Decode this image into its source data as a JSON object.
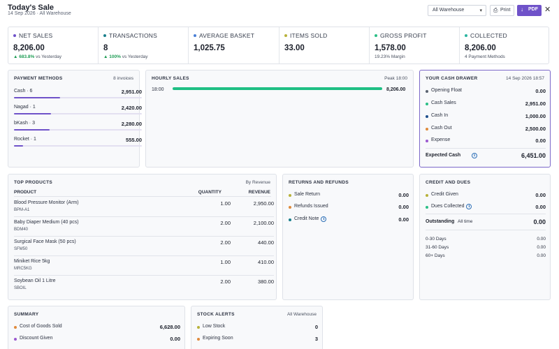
{
  "header": {
    "title": "Today's Sale",
    "subtitle": "14 Sep 2026 · All Warehouse",
    "warehouse_select": "All Warehouse",
    "print_label": "Print",
    "pdf_label": "PDF"
  },
  "kpis": [
    {
      "label": "NET SALES",
      "value": "8,206.00",
      "change": "683.8%",
      "change_text": "vs Yesterday",
      "dot": "#6f52c9"
    },
    {
      "label": "TRANSACTIONS",
      "value": "8",
      "change": "100%",
      "change_text": "vs Yesterday",
      "dot": "#1a7f8c"
    },
    {
      "label": "AVERAGE BASKET",
      "value": "1,025.75",
      "dot": "#4a7fd6"
    },
    {
      "label": "ITEMS SOLD",
      "value": "33.00",
      "dot": "#b8b23a"
    },
    {
      "label": "GROSS PROFIT",
      "value": "1,578.00",
      "sub": "19.23% Margin",
      "dot": "#2bbf86"
    },
    {
      "label": "COLLECTED",
      "value": "8,206.00",
      "sub": "4 Payment Methods",
      "dot": "#2bb5a0"
    }
  ],
  "payment_methods": {
    "title": "PAYMENT METHODS",
    "meta": "8 invoices",
    "items": [
      {
        "name": "Cash · 6",
        "amount": "2,951.00",
        "share": 0.36
      },
      {
        "name": "Nagad · 1",
        "amount": "2,420.00",
        "share": 0.29
      },
      {
        "name": "bKash · 3",
        "amount": "2,280.00",
        "share": 0.28
      },
      {
        "name": "Rocket · 1",
        "amount": "555.00",
        "share": 0.07
      }
    ]
  },
  "hourly_sales": {
    "title": "HOURLY SALES",
    "meta": "Peak 18:00"
  },
  "chart_data": {
    "type": "bar",
    "orientation": "horizontal",
    "categories": [
      "18:00"
    ],
    "values": [
      8206.0
    ],
    "value_labels": [
      "8,206.00"
    ],
    "color": "#1fbf84"
  },
  "cash_drawer": {
    "title": "YOUR CASH DRAWER",
    "meta": "14 Sep 2026 18:57",
    "items": [
      {
        "label": "Opening Float",
        "value": "0.00",
        "dot": "#5a6270"
      },
      {
        "label": "Cash Sales",
        "value": "2,951.00",
        "dot": "#2bbf86"
      },
      {
        "label": "Cash In",
        "value": "1,000.00",
        "dot": "#1f4f8c"
      },
      {
        "label": "Cash Out",
        "value": "2,500.00",
        "dot": "#e08a3c"
      },
      {
        "label": "Expense",
        "value": "0.00",
        "dot": "#9b59d0"
      }
    ],
    "expected_label": "Expected Cash",
    "expected_value": "6,451.00"
  },
  "top_products": {
    "title": "TOP PRODUCTS",
    "meta": "By Revenue",
    "columns": [
      "PRODUCT",
      "QUANTITY",
      "REVENUE"
    ],
    "rows": [
      {
        "name": "Blood Pressure Monitor (Arm)",
        "sku": "BPM-A1",
        "qty": "1.00",
        "revenue": "2,950.00"
      },
      {
        "name": "Baby Diaper Medium (40 pcs)",
        "sku": "BDM40",
        "qty": "2.00",
        "revenue": "2,100.00"
      },
      {
        "name": "Surgical Face Mask (50 pcs)",
        "sku": "SFM50",
        "qty": "2.00",
        "revenue": "440.00"
      },
      {
        "name": "Miniket Rice 5kg",
        "sku": "MRC5KG",
        "qty": "1.00",
        "revenue": "410.00"
      },
      {
        "name": "Soybean Oil 1 Litre",
        "sku": "SBOIL",
        "qty": "2.00",
        "revenue": "380.00"
      }
    ]
  },
  "returns": {
    "title": "RETURNS AND REFUNDS",
    "items": [
      {
        "label": "Sale Return",
        "value": "0.00",
        "dot": "#b8b23a"
      },
      {
        "label": "Refunds Issued",
        "value": "0.00",
        "dot": "#e08a3c"
      },
      {
        "label": "Credit Note",
        "value": "0.00",
        "dot": "#1a7f8c"
      }
    ]
  },
  "credit": {
    "title": "CREDIT AND DUES",
    "items": [
      {
        "label": "Credit Given",
        "value": "0.00",
        "dot": "#b8b23a"
      },
      {
        "label": "Dues Collected",
        "value": "0.00",
        "dot": "#2bbf86"
      }
    ],
    "outstanding_label": "Outstanding",
    "outstanding_period": "All time",
    "outstanding_value": "0.00",
    "aging": [
      {
        "label": "0-30 Days",
        "value": "0.00"
      },
      {
        "label": "31-60 Days",
        "value": "0.00"
      },
      {
        "label": "60+ Days",
        "value": "0.00"
      }
    ]
  },
  "summary": {
    "title": "SUMMARY",
    "items": [
      {
        "label": "Cost of Goods Sold",
        "value": "6,628.00",
        "dot": "#e08a3c"
      },
      {
        "label": "Discount Given",
        "value": "0.00",
        "dot": "#9b59d0"
      }
    ]
  },
  "stock_alerts": {
    "title": "STOCK ALERTS",
    "meta": "All Warehouse",
    "items": [
      {
        "label": "Low Stock",
        "value": "0",
        "dot": "#b8b23a"
      },
      {
        "label": "Expiring Soon",
        "value": "3",
        "dot": "#e08a3c"
      }
    ]
  }
}
